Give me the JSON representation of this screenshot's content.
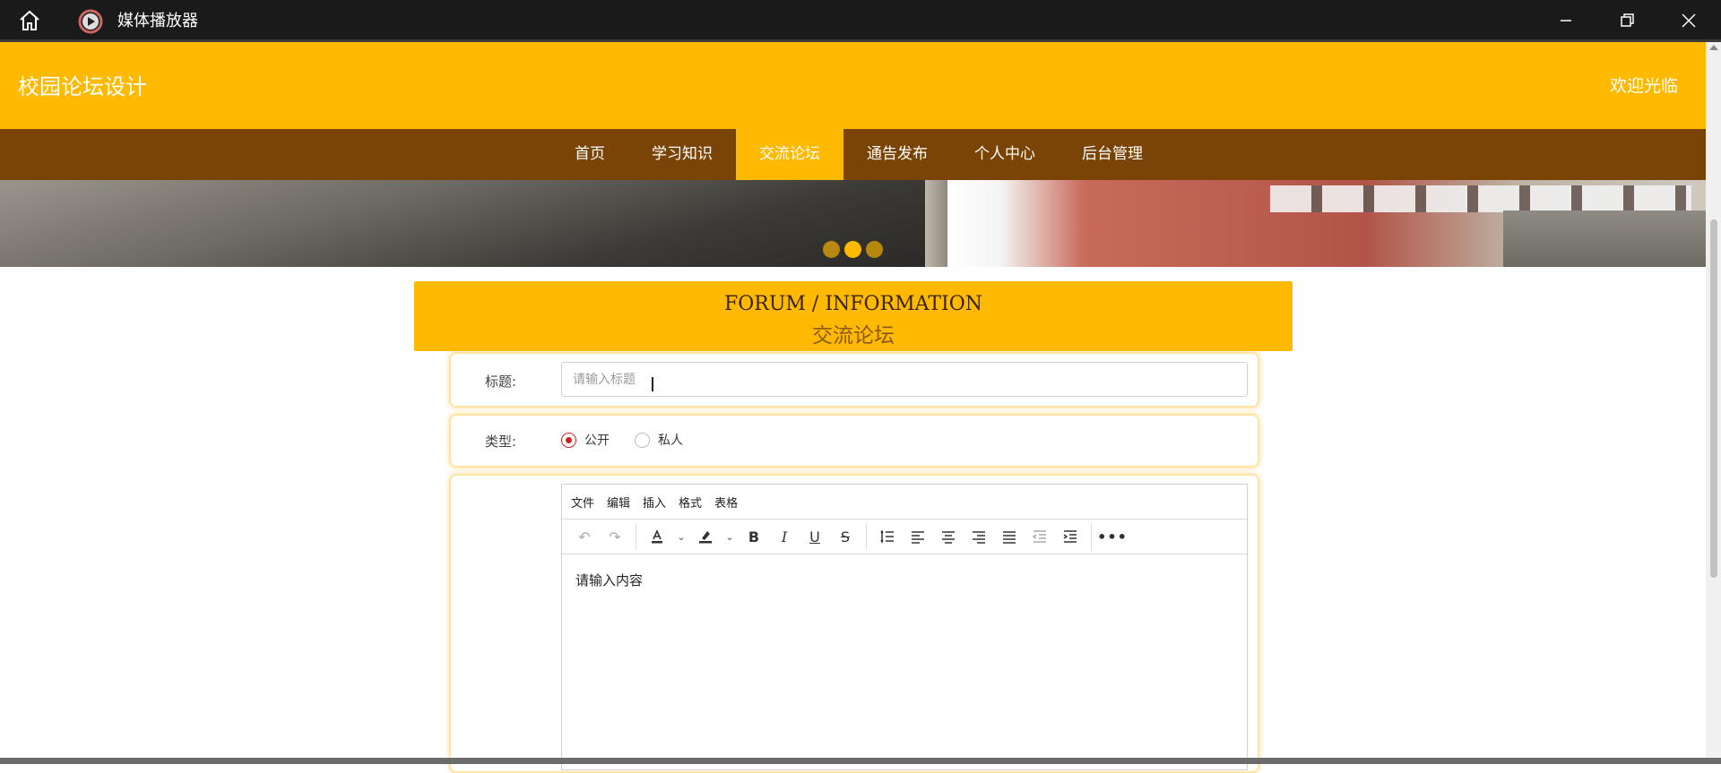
{
  "window": {
    "title": "媒体播放器",
    "home_icon": "home-icon",
    "app_icon": "play-icon"
  },
  "site": {
    "title": "校园论坛设计",
    "welcome": "欢迎光临"
  },
  "nav": {
    "items": [
      {
        "label": "首页",
        "active": false
      },
      {
        "label": "学习知识",
        "active": false
      },
      {
        "label": "交流论坛",
        "active": true
      },
      {
        "label": "通告发布",
        "active": false
      },
      {
        "label": "个人中心",
        "active": false
      },
      {
        "label": "后台管理",
        "active": false
      }
    ]
  },
  "banner": {
    "slides": 3,
    "active_slide": 2
  },
  "section": {
    "title_en": "FORUM / INFORMATION",
    "title_zh": "交流论坛"
  },
  "form": {
    "title_label": "标题:",
    "title_placeholder": "请输入标题",
    "title_value": "",
    "type_label": "类型:",
    "type_options": [
      {
        "label": "公开",
        "selected": true
      },
      {
        "label": "私人",
        "selected": false
      }
    ]
  },
  "editor": {
    "menus": [
      "文件",
      "编辑",
      "插入",
      "格式",
      "表格"
    ],
    "toolbar": [
      "undo-icon",
      "redo-icon",
      "text-color-icon",
      "highlight-icon",
      "bold-icon",
      "italic-icon",
      "underline-icon",
      "strikethrough-icon",
      "line-height-icon",
      "align-left-icon",
      "align-center-icon",
      "align-right-icon",
      "align-justify-icon",
      "outdent-icon",
      "indent-icon",
      "more-icon"
    ],
    "content": "请输入内容"
  },
  "colors": {
    "accent": "#ffb900",
    "nav_bg": "#7a4406",
    "radio_selected": "#cc2222"
  }
}
